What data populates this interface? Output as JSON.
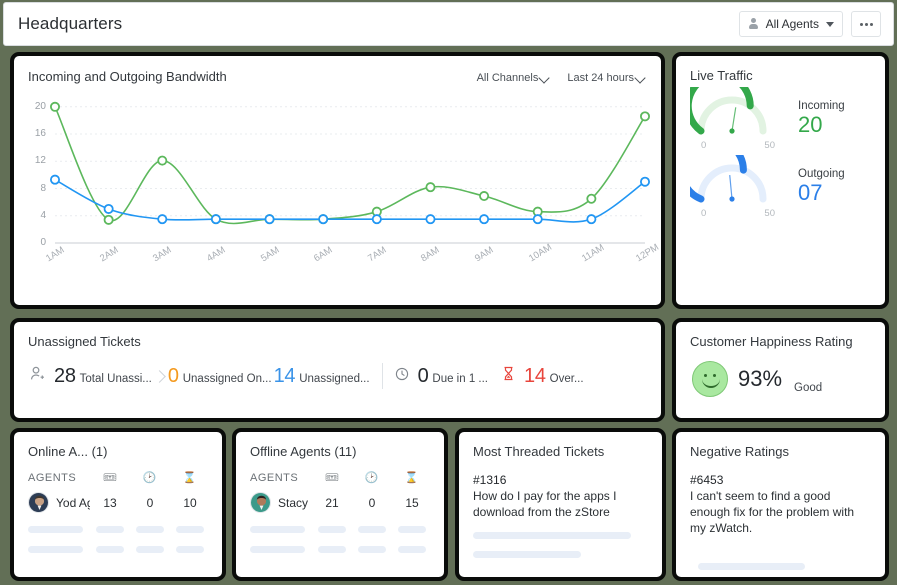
{
  "header": {
    "title": "Headquarters",
    "agents_filter": "All Agents",
    "agents_icon": "person-icon",
    "more_icon": "ellipsis-icon"
  },
  "bandwidth": {
    "title": "Incoming and Outgoing Bandwidth",
    "filter_channels": "All Channels",
    "filter_time": "Last 24 hours"
  },
  "chart_data": {
    "type": "line",
    "title": "Incoming and Outgoing Bandwidth",
    "xlabel": "",
    "ylabel": "",
    "x": [
      "1AM",
      "2AM",
      "3AM",
      "4AM",
      "5AM",
      "6AM",
      "7AM",
      "8AM",
      "9AM",
      "10AM",
      "11AM",
      "12PM"
    ],
    "yticks": [
      0,
      4,
      8,
      12,
      16,
      20
    ],
    "ylim": [
      0,
      21
    ],
    "grid": true,
    "legend": "none",
    "series": [
      {
        "name": "Incoming",
        "color": "#5cb85c",
        "values": [
          20,
          3.4,
          12.1,
          3.5,
          3.5,
          3.5,
          4.6,
          8.2,
          6.9,
          4.6,
          6.5,
          18.6
        ]
      },
      {
        "name": "Outgoing",
        "color": "#2196f3",
        "values": [
          9.3,
          5.0,
          3.5,
          3.5,
          3.5,
          3.5,
          3.5,
          3.5,
          3.5,
          3.5,
          3.5,
          9.0
        ]
      }
    ]
  },
  "live_traffic": {
    "title": "Live Traffic",
    "gauges": [
      {
        "label": "Incoming",
        "value": "20",
        "color": "#33a84a",
        "track": "#e2f3e2",
        "min": "0",
        "max": "50",
        "fill": 0.7,
        "needle": 0.55
      },
      {
        "label": "Outgoing",
        "value": "07",
        "color": "#2b7fe8",
        "track": "#e4eefc",
        "min": "0",
        "max": "50",
        "fill": 0.62,
        "needle": 0.47
      }
    ]
  },
  "unassigned": {
    "title": "Unassigned Tickets",
    "metrics": [
      {
        "icon": "person-add-icon",
        "value": "28",
        "label": "Total Unassi...",
        "color": "#25292e",
        "icon_color": "#8d9399"
      },
      {
        "icon": "none",
        "value": "0",
        "label": "Unassigned On...",
        "color": "#f49a1f",
        "icon_color": ""
      },
      {
        "icon": "none",
        "value": "14",
        "label": "Unassigned...",
        "color": "#3a93e8",
        "icon_color": ""
      },
      {
        "icon": "clock-icon",
        "value": "0",
        "label": "Due in 1 ...",
        "color": "#25292e",
        "icon_color": "#7d838a"
      },
      {
        "icon": "hourglass-icon",
        "value": "14",
        "label": "Over...",
        "color": "#e8453c",
        "icon_color": "#e8453c"
      }
    ]
  },
  "happiness": {
    "title": "Customer Happiness Rating",
    "icon": "smiley-face-icon",
    "percent": "93%",
    "word": "Good"
  },
  "online_agents": {
    "title": "Online A... (1)",
    "col_agents": "AGENTS",
    "col_icons": [
      "ticket-icon",
      "clock-icon",
      "hourglass-icon"
    ],
    "rows": [
      {
        "name": "Yod Ag...",
        "tickets": "13",
        "time": "0",
        "overdue": "10"
      }
    ]
  },
  "offline_agents": {
    "title": "Offline Agents (11)",
    "col_agents": "AGENTS",
    "col_icons": [
      "ticket-icon",
      "clock-icon",
      "hourglass-icon"
    ],
    "rows": [
      {
        "name": "Stacy",
        "tickets": "21",
        "time": "0",
        "overdue": "15"
      }
    ]
  },
  "threaded": {
    "title": "Most Threaded Tickets",
    "ticket_id": "#1316",
    "text": "How do I pay for the apps I download from the zStore"
  },
  "negative": {
    "title": "Negative Ratings",
    "ticket_id": "#6453",
    "text": "I can't seem to find a good enough fix for the problem with my zWatch."
  }
}
